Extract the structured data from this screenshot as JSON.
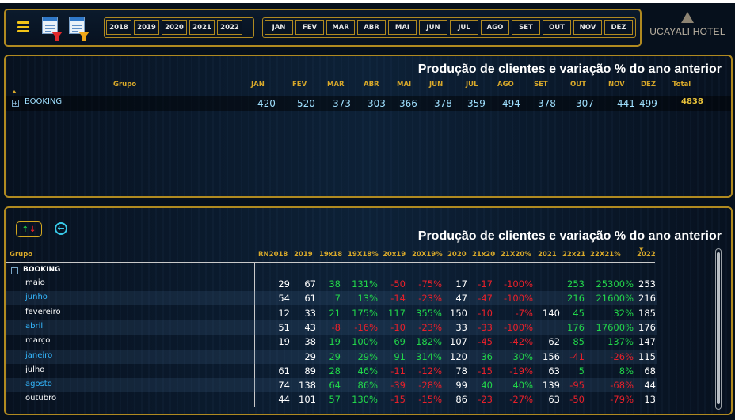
{
  "toolbar": {
    "years": [
      "2018",
      "2019",
      "2020",
      "2021",
      "2022"
    ],
    "months": [
      "JAN",
      "FEV",
      "MAR",
      "ABR",
      "MAI",
      "JUN",
      "JUL",
      "AGO",
      "SET",
      "OUT",
      "NOV",
      "DEZ"
    ]
  },
  "brand": {
    "name": "UCAYALI HOTEL"
  },
  "top_panel": {
    "title": "Produção de clientes e variação % do ano anterior",
    "headers": {
      "group": "Grupo",
      "jan": "JAN",
      "fev": "FEV",
      "mar": "MAR",
      "abr": "ABR",
      "mai": "MAI",
      "jun": "JUN",
      "jul": "JUL",
      "ago": "AGO",
      "set": "SET",
      "out": "OUT",
      "nov": "NOV",
      "dez": "DEZ",
      "total": "Total"
    },
    "row": {
      "expand": "+",
      "group": "BOOKING",
      "jan": "420",
      "fev": "520",
      "mar": "373",
      "abr": "303",
      "mai": "366",
      "jun": "378",
      "jul": "359",
      "ago": "494",
      "set": "378",
      "out": "307",
      "nov": "441",
      "dez": "499",
      "total": "4838"
    }
  },
  "bottom_panel": {
    "title": "Produção de clientes e variação % do ano anterior",
    "toggle": {
      "up": "↑",
      "down": "↓"
    },
    "back": "←",
    "headers": {
      "group": "Grupo",
      "rn2018": "RN2018",
      "y2019": "2019",
      "c19x18": "19x18",
      "c19x18p": "19X18%",
      "c20x19": "20x19",
      "c20x19p": "20X19%",
      "y2020": "2020",
      "c21x20": "21x20",
      "c21x20p": "21X20%",
      "y2021": "2021",
      "c22x21": "22x21",
      "c22x21p": "22X21%",
      "y2022": "2022"
    },
    "group_row": {
      "collapse": "−",
      "label": "BOOKING"
    },
    "rows": [
      {
        "label": "maio",
        "rn2018": "29",
        "y2019": "67",
        "c19x18": "38",
        "c19x18p": "131%",
        "c20x19": "-50",
        "c20x19p": "-75%",
        "y2020": "17",
        "c21x20": "-17",
        "c21x20p": "-100%",
        "y2021": "",
        "c22x21": "253",
        "c22x21p": "25300%",
        "y2022": "253"
      },
      {
        "label": "junho",
        "rn2018": "54",
        "y2019": "61",
        "c19x18": "7",
        "c19x18p": "13%",
        "c20x19": "-14",
        "c20x19p": "-23%",
        "y2020": "47",
        "c21x20": "-47",
        "c21x20p": "-100%",
        "y2021": "",
        "c22x21": "216",
        "c22x21p": "21600%",
        "y2022": "216"
      },
      {
        "label": "fevereiro",
        "rn2018": "12",
        "y2019": "33",
        "c19x18": "21",
        "c19x18p": "175%",
        "c20x19": "117",
        "c20x19p": "355%",
        "y2020": "150",
        "c21x20": "-10",
        "c21x20p": "-7%",
        "y2021": "140",
        "c22x21": "45",
        "c22x21p": "32%",
        "y2022": "185"
      },
      {
        "label": "abril",
        "rn2018": "51",
        "y2019": "43",
        "c19x18": "-8",
        "c19x18p": "-16%",
        "c20x19": "-10",
        "c20x19p": "-23%",
        "y2020": "33",
        "c21x20": "-33",
        "c21x20p": "-100%",
        "y2021": "",
        "c22x21": "176",
        "c22x21p": "17600%",
        "y2022": "176"
      },
      {
        "label": "março",
        "rn2018": "19",
        "y2019": "38",
        "c19x18": "19",
        "c19x18p": "100%",
        "c20x19": "69",
        "c20x19p": "182%",
        "y2020": "107",
        "c21x20": "-45",
        "c21x20p": "-42%",
        "y2021": "62",
        "c22x21": "85",
        "c22x21p": "137%",
        "y2022": "147"
      },
      {
        "label": "janeiro",
        "rn2018": "",
        "y2019": "29",
        "c19x18": "29",
        "c19x18p": "29%",
        "c20x19": "91",
        "c20x19p": "314%",
        "y2020": "120",
        "c21x20": "36",
        "c21x20p": "30%",
        "y2021": "156",
        "c22x21": "-41",
        "c22x21p": "-26%",
        "y2022": "115"
      },
      {
        "label": "julho",
        "rn2018": "61",
        "y2019": "89",
        "c19x18": "28",
        "c19x18p": "46%",
        "c20x19": "-11",
        "c20x19p": "-12%",
        "y2020": "78",
        "c21x20": "-15",
        "c21x20p": "-19%",
        "y2021": "63",
        "c22x21": "5",
        "c22x21p": "8%",
        "y2022": "68"
      },
      {
        "label": "agosto",
        "rn2018": "74",
        "y2019": "138",
        "c19x18": "64",
        "c19x18p": "86%",
        "c20x19": "-39",
        "c20x19p": "-28%",
        "y2020": "99",
        "c21x20": "40",
        "c21x20p": "40%",
        "y2021": "139",
        "c22x21": "-95",
        "c22x21p": "-68%",
        "y2022": "44"
      },
      {
        "label": "outubro",
        "rn2018": "44",
        "y2019": "101",
        "c19x18": "57",
        "c19x18p": "130%",
        "c20x19": "-15",
        "c20x19p": "-15%",
        "y2020": "86",
        "c21x20": "-23",
        "c21x20p": "-27%",
        "y2021": "63",
        "c22x21": "-50",
        "c22x21p": "-79%",
        "y2022": "13"
      }
    ]
  },
  "colors": {
    "accent": "#b08a20",
    "header": "#d9a92a",
    "positive": "#22d64a",
    "negative": "#e8202a",
    "link": "#34b8ff"
  },
  "icons": [
    "menu-icon",
    "filter-icon",
    "sort-icon",
    "back-icon",
    "scrollbar"
  ]
}
